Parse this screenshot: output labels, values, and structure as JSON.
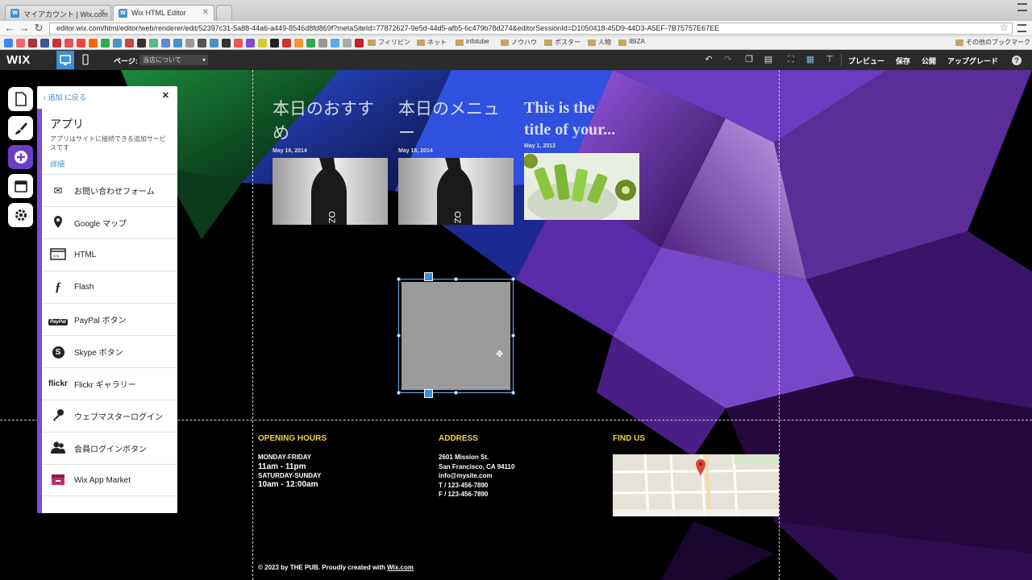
{
  "browser": {
    "tabs": [
      {
        "title": "マイアカウント | Wix.com"
      },
      {
        "title": "Wix HTML Editor"
      }
    ],
    "url": "editor.wix.com/html/editor/web/renderer/edit/52397c31-5a88-44a6-a449-8546d8fd869f?metaSiteId=77872627-9e5d-44d5-afb5-6c479b78d274&editorSessionId=D1050418-45D9-44D3-A5EF-7B75757E67EE",
    "bookmarks": [
      "フィリピン",
      "ネット",
      "infotube",
      "ノウハウ",
      "ポスター",
      "人物",
      "IBIZA"
    ],
    "other_bookmarks": "その他のブックマーク"
  },
  "editor": {
    "logo": "WIX",
    "page_label": "ページ:",
    "page_value": "当店について",
    "actions": {
      "preview": "プレビュー",
      "save": "保存",
      "publish": "公開",
      "upgrade": "アップグレード"
    }
  },
  "panel": {
    "back": "追加 に戻る",
    "title": "アプリ",
    "description": "アプリはサイトに接続できる追加サービスです",
    "details_link": "詳細",
    "items": [
      {
        "label": "お問い合わせフォーム",
        "icon": "envelope-icon"
      },
      {
        "label": "Google マップ",
        "icon": "map-pin-icon"
      },
      {
        "label": "HTML",
        "icon": "html-icon"
      },
      {
        "label": "Flash",
        "icon": "flash-icon"
      },
      {
        "label": "PayPal ボタン",
        "icon": "paypal-icon",
        "icon_text": "PayPal"
      },
      {
        "label": "Skype ボタン",
        "icon": "skype-icon"
      },
      {
        "label": "Flickr ギャラリー",
        "icon": "flickr-icon",
        "icon_text": "flickr"
      },
      {
        "label": "ウェブマスターログイン",
        "icon": "key-icon"
      },
      {
        "label": "会員ログインボタン",
        "icon": "members-icon"
      },
      {
        "label": "Wix App Market",
        "icon": "app-market-icon"
      }
    ]
  },
  "site": {
    "posts": [
      {
        "title_line1": "本日のおすす",
        "title_line2": "め",
        "date": "May 16, 2014"
      },
      {
        "title_line1": "本日のメニュ",
        "title_line2": "ー",
        "date": "May 16, 2014"
      },
      {
        "title_line1": "This is the",
        "title_line2": "title of your...",
        "date": "May 1, 2013"
      }
    ],
    "footer": {
      "hours_heading": "OPENING HOURS",
      "hours_days1": "MONDAY-FRIDAY",
      "hours_time1": "11am - 11pm",
      "hours_days2": "SATURDAY-SUNDAY",
      "hours_time2": "10am - 12:00am",
      "address_heading": "ADDRESS",
      "address_lines": [
        "2601 Mission St.",
        "San Francisco, CA 94110",
        "info@mysite.com",
        "T  /  123-456-7890",
        "F  /  123-456-7890"
      ],
      "find_heading": "FIND US",
      "copyright": "© 2023 by  THE PUB. Proudly created with",
      "copyright_link": "Wix.com"
    }
  }
}
